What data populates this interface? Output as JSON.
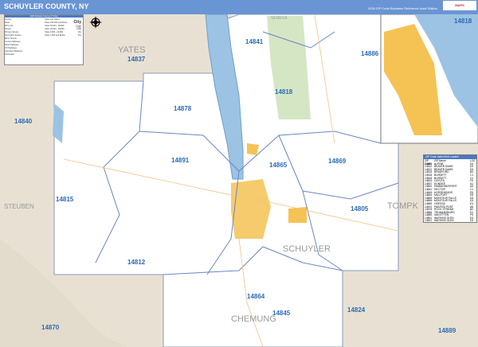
{
  "header": {
    "title": "SCHUYLER COUNTY, NY",
    "edition": "2026 ZIP Code Business Reference Inset Edition",
    "logo": "MAPS"
  },
  "counties": [
    "YATES",
    "STEUBEN",
    "TOMPK",
    "SCHUYLER",
    "CHEMUNG",
    "SENECA"
  ],
  "zips": [
    "14837",
    "14841",
    "14886",
    "14818",
    "14878",
    "14840",
    "14891",
    "14865",
    "14869",
    "14815",
    "14805",
    "14812",
    "14864",
    "14845",
    "14824",
    "14870",
    "14889"
  ],
  "inset": {
    "zip": "14818"
  },
  "legend": {
    "title": "2026 Schuyler County, NY Map",
    "items": [
      "County",
      "State",
      "ZIP Code",
      "Streets",
      "Primary Streets",
      "Secondary Streets",
      "Minor Streets",
      "County Highways",
      "State Highways",
      "US Highways",
      "Interstate Highways",
      "Toll Roads"
    ],
    "cities_title": "Cities and Towns",
    "cities": [
      "Cities 100,000 and Above",
      "Cities 50,000 - 99,999",
      "Cities 25,000 - 49,999",
      "Cities 5,000 - 24,999",
      "Cities 1,000 and Below"
    ],
    "city_samples": [
      "City",
      "City",
      "City",
      "City",
      "City"
    ]
  },
  "colors": {
    "header": "#6a95d4",
    "water": "#9cc3e3",
    "county": "#ffffff",
    "surround": "#e8e1d3",
    "park": "#d5e6c4",
    "urban": "#f5c254"
  },
  "zip_index": {
    "title": "ZIP Code Index/Grid Locator",
    "headers": [
      "ZIP Code",
      "ZIP Name",
      "LOC"
    ],
    "rows": [
      [
        "14805",
        "ALPINE",
        "D4"
      ],
      [
        "14812",
        "BEAVER DAMS",
        "D4"
      ],
      [
        "14812",
        "BEAVER DAMS",
        "D4"
      ],
      [
        "14815",
        "BRADFORD",
        "B3"
      ],
      [
        "14818",
        "BURDETT",
        "C1"
      ],
      [
        "14818",
        "BURDETT",
        "C1"
      ],
      [
        "14824",
        "CAYUTA",
        "F5"
      ],
      [
        "14837",
        "DUNDEE",
        "A1"
      ],
      [
        "14840",
        "HAMMONDSPORT",
        "A3"
      ],
      [
        "14841",
        "HECTOR",
        "C1"
      ],
      [
        "14845",
        "HORSEHEADS",
        "E5"
      ],
      [
        "14864",
        "MILLPORT",
        "D5"
      ],
      [
        "14865",
        "MONTOUR FALLS",
        "D3"
      ],
      [
        "14865",
        "MONTOUR FALLS",
        "D3"
      ],
      [
        "14869",
        "ODESSA",
        "E3"
      ],
      [
        "14870",
        "PAINTED POST",
        "A5"
      ],
      [
        "14878",
        "ROCK STREAM",
        "B2"
      ],
      [
        "14886",
        "TRUMANSBURG",
        "E1"
      ],
      [
        "14889",
        "VAN ETTEN",
        "F5"
      ],
      [
        "14891",
        "WATKINS GLEN",
        "D3"
      ],
      [
        "14891",
        "WATKINS GLEN",
        "D3"
      ]
    ]
  }
}
